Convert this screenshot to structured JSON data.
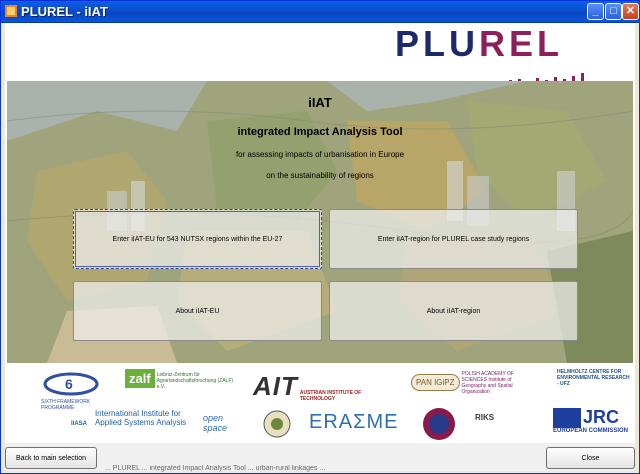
{
  "window": {
    "title": "PLUREL - iIAT",
    "minimize_label": "_",
    "maximize_label": "□",
    "close_label": "✕"
  },
  "logo": {
    "text_a": "PLU",
    "text_b": "REL"
  },
  "header": {
    "title": "iIAT",
    "subtitle": "integrated Impact Analysis Tool",
    "line3": "for assessing impacts of urbanisation in Europe",
    "line4": "on the sustainability of regions"
  },
  "buttons": {
    "enter_eu": "Enter iIAT-EU for 543 NUTSX regions within the EU-27",
    "enter_region": "Enter iIAT-region for PLUREL case study regions",
    "about_eu": "About iIAT-EU",
    "about_region": "About iIAT-region",
    "back": "Back to main selection",
    "close": "Close"
  },
  "partners": {
    "fp6": "SIXTH FRAMEWORK PROGRAMME",
    "zalf": "zalf",
    "zalf_sub": "Leibniz-Zentrum für Agrarlandschaftsforschung (ZALF) e.V.",
    "ait": "AIT",
    "ait_sub": "AUSTRIAN INSTITUTE OF TECHNOLOGY",
    "pan": "PAN IGiPZ",
    "pan_sub": "POLISH ACADEMY OF SCIENCES Institute of Geography and Spatial Organization",
    "helmholtz": "HELMHOLTZ CENTRE FOR ENVIRONMENTAL RESEARCH - UFZ",
    "iiasa": "IIASA",
    "iiasa_sub": "International Institute for Applied Systems Analysis",
    "openspace": "open space",
    "erasme": "ERAΣME",
    "riks": "RIKS",
    "jrc": "JRC",
    "jrc_sub": "EUROPEAN COMMISSION"
  },
  "ticker": "... PLUREL ... integrated Impact Analysis Tool ... urban-rural linkages ..."
}
